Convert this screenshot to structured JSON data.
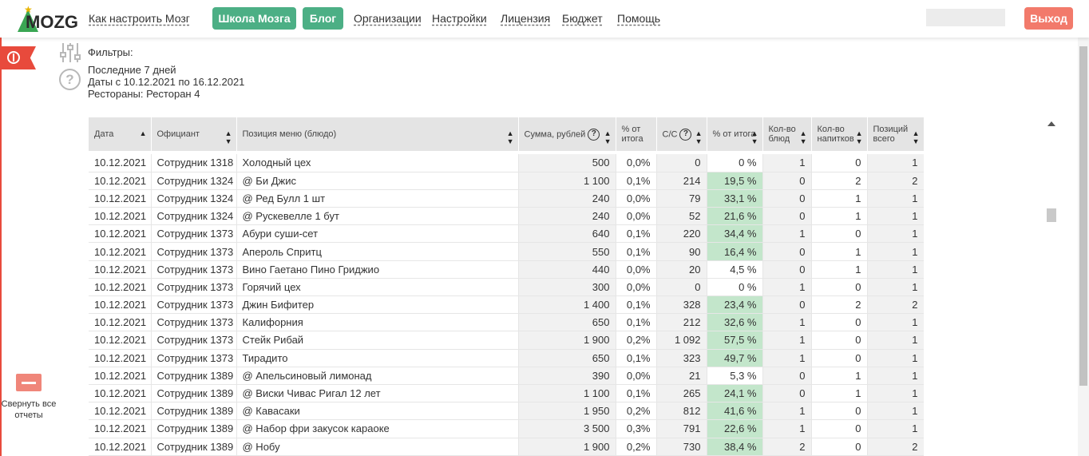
{
  "header": {
    "logo_text": "MOZG",
    "how_to_link": "Как настроить Мозг",
    "school_button": "Школа Мозга",
    "blog_button": "Блог",
    "nav": [
      "Организации",
      "Настройки",
      "Лицензия",
      "Бюджет",
      "Помощь"
    ],
    "logout_button": "Выход"
  },
  "sidebar": {
    "collapse_label": "Свернуть все отчеты"
  },
  "filters": {
    "title": "Фильтры:",
    "period": "Последние 7 дней",
    "dates_label": "Даты",
    "dates_value": "с 10.12.2021 по 16.12.2021",
    "restaurants_label": "Рестораны:",
    "restaurants_value": "Ресторан 4"
  },
  "table": {
    "headers": {
      "date": "Дата",
      "waiter": "Официант",
      "item": "Позиция меню (блюдо)",
      "sum": "Сумма, рублей",
      "pct_total": "% от итога",
      "cost": "С/С",
      "pct_cost": "% от итога",
      "dishes": "Кол-во блюд",
      "drinks": "Кол-во напитков",
      "positions": "Позиций всего"
    },
    "rows": [
      {
        "date": "10.12.2021",
        "waiter": "Сотрудник 1318",
        "item": "Холодный цех",
        "sum": "500",
        "pct": "0,0%",
        "cost": "0",
        "costpct": "0 %",
        "dishes": "1",
        "drinks": "0",
        "total": "1",
        "hl": false
      },
      {
        "date": "10.12.2021",
        "waiter": "Сотрудник 1324",
        "item": "@ Би Джис",
        "sum": "1 100",
        "pct": "0,1%",
        "cost": "214",
        "costpct": "19,5 %",
        "dishes": "0",
        "drinks": "2",
        "total": "2",
        "hl": true
      },
      {
        "date": "10.12.2021",
        "waiter": "Сотрудник 1324",
        "item": "@ Ред Булл 1 шт",
        "sum": "240",
        "pct": "0,0%",
        "cost": "79",
        "costpct": "33,1 %",
        "dishes": "0",
        "drinks": "1",
        "total": "1",
        "hl": true
      },
      {
        "date": "10.12.2021",
        "waiter": "Сотрудник 1324",
        "item": "@ Рускевелле 1 бут",
        "sum": "240",
        "pct": "0,0%",
        "cost": "52",
        "costpct": "21,6 %",
        "dishes": "0",
        "drinks": "1",
        "total": "1",
        "hl": true
      },
      {
        "date": "10.12.2021",
        "waiter": "Сотрудник 1373",
        "item": "Абури суши-сет",
        "sum": "640",
        "pct": "0,1%",
        "cost": "220",
        "costpct": "34,4 %",
        "dishes": "1",
        "drinks": "0",
        "total": "1",
        "hl": true
      },
      {
        "date": "10.12.2021",
        "waiter": "Сотрудник 1373",
        "item": "Апероль Спритц",
        "sum": "550",
        "pct": "0,1%",
        "cost": "90",
        "costpct": "16,4 %",
        "dishes": "0",
        "drinks": "1",
        "total": "1",
        "hl": true
      },
      {
        "date": "10.12.2021",
        "waiter": "Сотрудник 1373",
        "item": "Вино Гаетано Пино Гриджио",
        "sum": "440",
        "pct": "0,0%",
        "cost": "20",
        "costpct": "4,5 %",
        "dishes": "0",
        "drinks": "1",
        "total": "1",
        "hl": false
      },
      {
        "date": "10.12.2021",
        "waiter": "Сотрудник 1373",
        "item": "Горячий цех",
        "sum": "300",
        "pct": "0,0%",
        "cost": "0",
        "costpct": "0 %",
        "dishes": "1",
        "drinks": "0",
        "total": "1",
        "hl": false
      },
      {
        "date": "10.12.2021",
        "waiter": "Сотрудник 1373",
        "item": "Джин Бифитер",
        "sum": "1 400",
        "pct": "0,1%",
        "cost": "328",
        "costpct": "23,4 %",
        "dishes": "0",
        "drinks": "2",
        "total": "2",
        "hl": true
      },
      {
        "date": "10.12.2021",
        "waiter": "Сотрудник 1373",
        "item": "Калифорния",
        "sum": "650",
        "pct": "0,1%",
        "cost": "212",
        "costpct": "32,6 %",
        "dishes": "1",
        "drinks": "0",
        "total": "1",
        "hl": true
      },
      {
        "date": "10.12.2021",
        "waiter": "Сотрудник 1373",
        "item": "Стейк Рибай",
        "sum": "1 900",
        "pct": "0,2%",
        "cost": "1 092",
        "costpct": "57,5 %",
        "dishes": "1",
        "drinks": "0",
        "total": "1",
        "hl": true
      },
      {
        "date": "10.12.2021",
        "waiter": "Сотрудник 1373",
        "item": "Тирадито",
        "sum": "650",
        "pct": "0,1%",
        "cost": "323",
        "costpct": "49,7 %",
        "dishes": "1",
        "drinks": "0",
        "total": "1",
        "hl": true
      },
      {
        "date": "10.12.2021",
        "waiter": "Сотрудник 1389",
        "item": "@ Апельсиновый лимонад",
        "sum": "390",
        "pct": "0,0%",
        "cost": "21",
        "costpct": "5,3 %",
        "dishes": "0",
        "drinks": "1",
        "total": "1",
        "hl": false
      },
      {
        "date": "10.12.2021",
        "waiter": "Сотрудник 1389",
        "item": "@ Виски Чивас Ригал 12 лет",
        "sum": "1 100",
        "pct": "0,1%",
        "cost": "265",
        "costpct": "24,1 %",
        "dishes": "0",
        "drinks": "1",
        "total": "1",
        "hl": true
      },
      {
        "date": "10.12.2021",
        "waiter": "Сотрудник 1389",
        "item": "@ Кавасаки",
        "sum": "1 950",
        "pct": "0,2%",
        "cost": "812",
        "costpct": "41,6 %",
        "dishes": "1",
        "drinks": "0",
        "total": "1",
        "hl": true
      },
      {
        "date": "10.12.2021",
        "waiter": "Сотрудник 1389",
        "item": "@ Набор фри закусок караоке",
        "sum": "3 500",
        "pct": "0,3%",
        "cost": "791",
        "costpct": "22,6 %",
        "dishes": "1",
        "drinks": "0",
        "total": "1",
        "hl": true
      },
      {
        "date": "10.12.2021",
        "waiter": "Сотрудник 1389",
        "item": "@ Нобу",
        "sum": "1 900",
        "pct": "0,2%",
        "cost": "730",
        "costpct": "38,4 %",
        "dishes": "2",
        "drinks": "0",
        "total": "2",
        "hl": true
      }
    ]
  },
  "colors": {
    "accent_green": "#4caf85",
    "logout_red": "#f27a6b",
    "highlight_green": "#c3e6cb"
  }
}
